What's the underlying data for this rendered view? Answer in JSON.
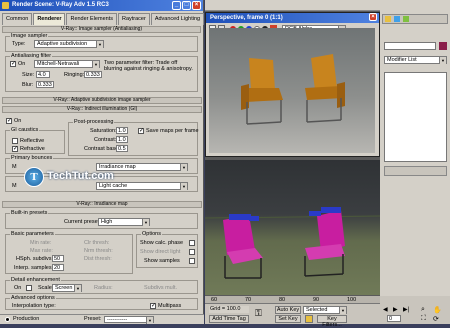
{
  "render_dialog": {
    "title": "Render Scene: V-Ray Adv 1.5 RC3",
    "tabs": [
      "Common",
      "Renderer",
      "Render Elements",
      "Raytracer",
      "Advanced Lighting"
    ],
    "rollout_image_sampler": "V-Ray:: Image sampler (Antialiasing)",
    "image_sampler": {
      "group_title": "Image sampler",
      "type_label": "Type:",
      "type_value": "Adaptive subdivision"
    },
    "aa_filter": {
      "group_title": "Antialiasing filter",
      "on_label": "On",
      "filter_value": "Mitchell-Netravali",
      "description": "Two parameter filter: Trade off blurring against ringing & anisotropy.",
      "size_label": "Size:",
      "size_value": "4.0",
      "ringing_label": "Ringing:",
      "ringing_value": "0.333",
      "blur_label": "Blur:",
      "blur_value": "0.333"
    },
    "rollout_adaptive": "V-Ray:: Adaptive subdivision image sampler",
    "rollout_indirect": "V-Ray:: Indirect illumination (GI)",
    "gi": {
      "on_label": "On",
      "gi_caustics_title": "GI caustics",
      "reflective_label": "Reflective",
      "refractive_label": "Refractive",
      "post_processing_title": "Post-processing",
      "saturation_label": "Saturation:",
      "saturation_value": "1.0",
      "contrast_label": "Contrast:",
      "contrast_value": "1.0",
      "contrast_base_label": "Contrast base:",
      "contrast_base_value": "0.5",
      "save_maps_label": "Save maps per frame"
    },
    "primary_bounces": {
      "group_title": "Primary bounces",
      "multiplier_label": "M",
      "engine_value": "Irradiance map"
    },
    "secondary_bounces": {
      "multiplier_label": "M",
      "engine_value": "Light cache"
    },
    "rollout_irradiance": "V-Ray:: Irradiance map",
    "builtin_presets": {
      "group_title": "Built-in presets",
      "current_preset_label": "Current preset:",
      "current_preset_value": "High"
    },
    "basic_parameters": {
      "group_title": "Basic parameters",
      "min_rate_label": "Min rate:",
      "max_rate_label": "Max rate:",
      "hsph_label": "HSph. subdivs:",
      "hsph_value": "50",
      "interp_label": "Interp. samples:",
      "interp_value": "20",
      "clr_thresh_label": "Clr thresh:",
      "nrm_thresh_label": "Nrm thresh:",
      "dist_thresh_label": "Dist thresh:"
    },
    "options": {
      "group_title": "Options",
      "show_calc_label": "Show calc. phase",
      "show_direct_label": "Show direct light",
      "show_samples_label": "Show samples"
    },
    "detail_enhancement": {
      "group_title": "Detail enhancement",
      "on_label": "On",
      "scale_label": "Scale:",
      "scale_value": "Screen",
      "radius_label": "Radius:",
      "subdivs_label": "Subdivs mult."
    },
    "advanced_options": {
      "group_title": "Advanced options",
      "interp_type_label": "Interpolation type:",
      "multipass_label": "Multipass"
    },
    "footer": {
      "production_label": "Production",
      "preset_label": "Preset:",
      "preset_value": "-----------"
    }
  },
  "frame_window": {
    "title": "Perspective, frame 0 (1:1)",
    "channel_value": "RGB Alpha"
  },
  "right_panel": {
    "modifier_list": "Modifier List"
  },
  "timeline": {
    "ticks": [
      "60",
      "70",
      "80",
      "90",
      "100"
    ],
    "grid_label": "Grid = 100.0",
    "auto_key_label": "Auto Key",
    "selected_value": "Selected",
    "set_key_label": "Set Key",
    "key_filters_label": "Key Filters...",
    "add_time_tag_label": "Add Time Tag",
    "frame_value": "0"
  },
  "watermark": {
    "text": "TechTut.com"
  },
  "colors": {
    "title_blue": "#1e4fb8",
    "chair_orange": "#c8841e",
    "chair_magenta": "#c81ea0",
    "cushion_blue": "#2a3ac8",
    "dialog_gray": "#d4d0c8"
  }
}
